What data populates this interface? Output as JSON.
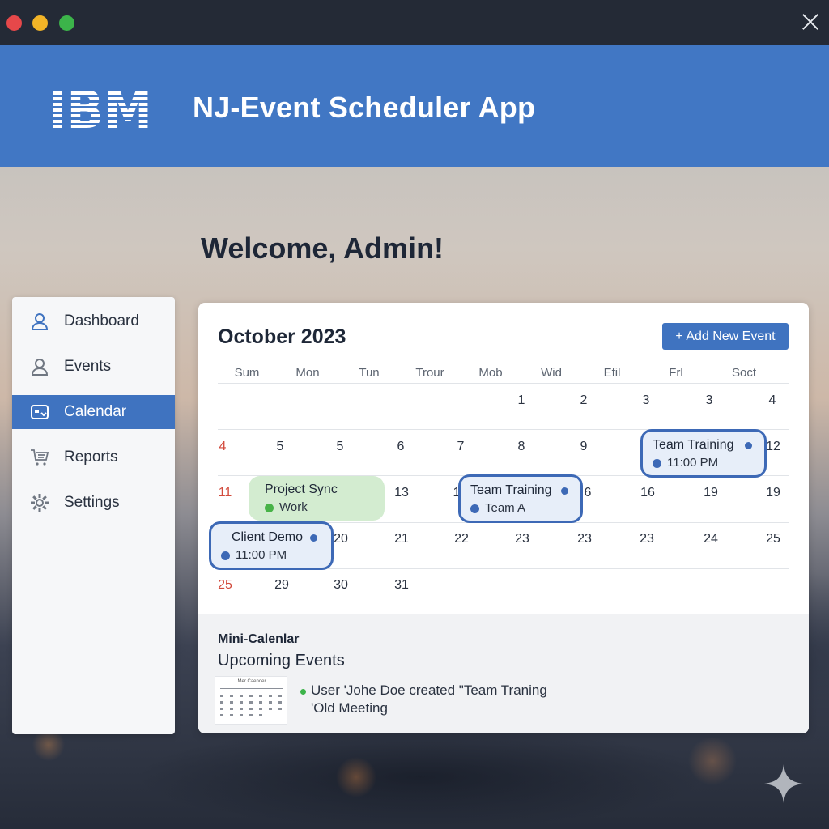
{
  "window": {
    "close_label": "Close"
  },
  "header": {
    "logo_text": "IBM",
    "title": "NJ-Event Scheduler App"
  },
  "welcome": "Welcome, Admin!",
  "sidebar": {
    "items": [
      {
        "label": "Dashboard",
        "icon": "user-icon"
      },
      {
        "label": "Events",
        "icon": "user-icon"
      },
      {
        "label": "Calendar",
        "icon": "calendar-icon",
        "active": true
      },
      {
        "label": "Reports",
        "icon": "cart-icon"
      },
      {
        "label": "Settings",
        "icon": "gear-icon"
      }
    ]
  },
  "calendar": {
    "month": "October 2023",
    "add_button": "+ Add New Event",
    "weekdays": [
      "Sum",
      "Mon",
      "Tun",
      "Trour",
      "Mob",
      "Wid",
      "Efil",
      "Frl",
      "Soct"
    ],
    "rows": [
      [
        "",
        "",
        "",
        "",
        "",
        "1",
        "2",
        "3",
        "3",
        "4"
      ],
      [
        "4",
        "5",
        "5",
        "6",
        "7",
        "8",
        "9",
        "",
        "",
        "12"
      ],
      [
        "11",
        "",
        "",
        "13",
        "1",
        "",
        "6",
        "16",
        "19",
        "19"
      ],
      [
        "1",
        "",
        "20",
        "21",
        "22",
        "23",
        "23",
        "23",
        "24",
        "25"
      ],
      [
        "25",
        "29",
        "30",
        "31"
      ]
    ],
    "events": [
      {
        "title": "Team Training",
        "sub": "11:00 PM"
      },
      {
        "title": "Project Sync",
        "sub": "Work"
      },
      {
        "title": "Team Training",
        "sub": "Team A"
      },
      {
        "title": "Client Demo",
        "sub": "11:00 PM"
      }
    ]
  },
  "bottom": {
    "mini_title": "Mini-Calenlar",
    "upcoming_title": "Upcoming Events",
    "mini_cal_header": "Mer Caender",
    "upcoming_lines": [
      "User 'Johe Doe created \"Team Traning",
      "'Old Meeting"
    ]
  },
  "colors": {
    "brand": "#4177c4",
    "accent": "#3f73c0",
    "event_blue": "#3d69b6",
    "event_green": "#d3ecd0",
    "weekend_red": "#d24a3c"
  }
}
